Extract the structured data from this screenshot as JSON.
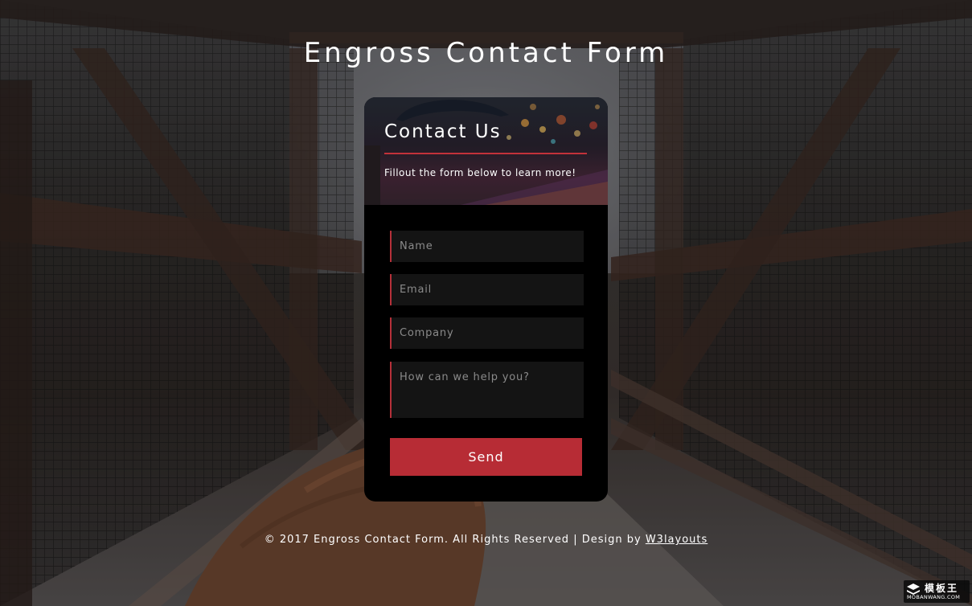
{
  "page": {
    "title": "Engross Contact Form"
  },
  "card": {
    "title": "Contact Us",
    "subtitle": "Fillout the form below to learn more!"
  },
  "form": {
    "name_placeholder": "Name",
    "email_placeholder": "Email",
    "company_placeholder": "Company",
    "message_placeholder": "How can we help you?",
    "send_label": "Send"
  },
  "footer": {
    "text": "© 2017 Engross Contact Form. All Rights Reserved | Design by ",
    "link_label": "W3layouts"
  },
  "watermark": {
    "brand": "模板王",
    "domain": "MOBANWANG.COM"
  },
  "colors": {
    "accent": "#b72c35",
    "card_background": "#000000",
    "field_background": "#141414"
  },
  "icons": {
    "watermark_logo": "stacked-layers-icon"
  }
}
